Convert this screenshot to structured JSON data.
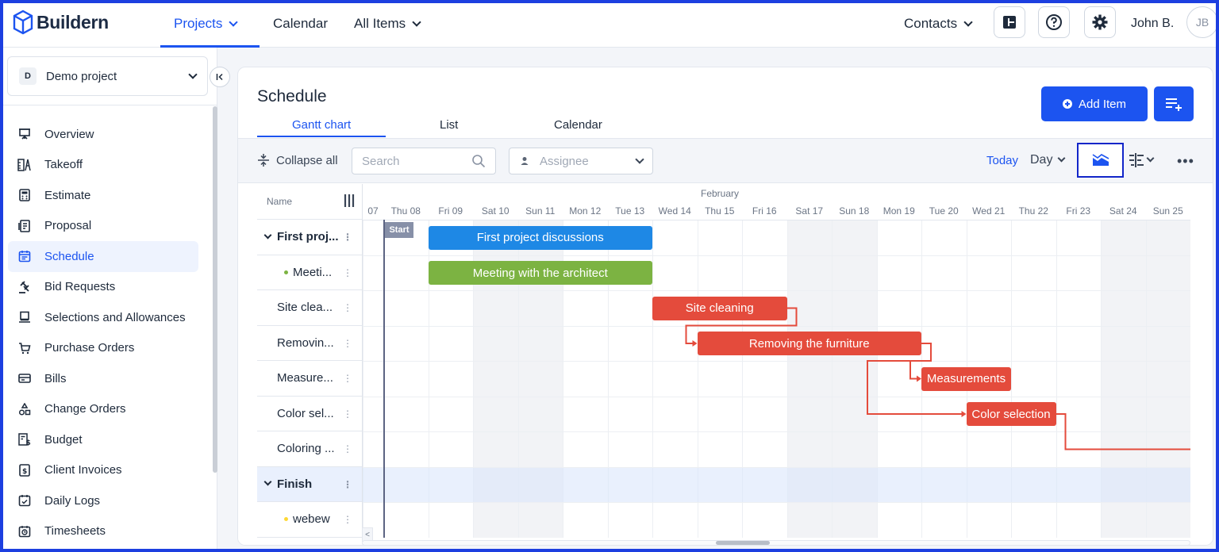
{
  "app": {
    "name": "Buildern"
  },
  "topnav": {
    "projects": "Projects",
    "calendar": "Calendar",
    "all_items": "All Items",
    "contacts": "Contacts",
    "user_name": "John B.",
    "user_initials": "JB"
  },
  "sidebar": {
    "project_initial": "D",
    "project_name": "Demo project",
    "items": [
      {
        "label": "Overview",
        "icon": "presentation-icon"
      },
      {
        "label": "Takeoff",
        "icon": "takeoff-icon"
      },
      {
        "label": "Estimate",
        "icon": "calculator-icon"
      },
      {
        "label": "Proposal",
        "icon": "proposal-icon"
      },
      {
        "label": "Schedule",
        "icon": "calendar-icon"
      },
      {
        "label": "Bid Requests",
        "icon": "gavel-icon"
      },
      {
        "label": "Selections and Allowances",
        "icon": "monitor-icon"
      },
      {
        "label": "Purchase Orders",
        "icon": "cart-icon"
      },
      {
        "label": "Bills",
        "icon": "bill-icon"
      },
      {
        "label": "Change Orders",
        "icon": "shapes-icon"
      },
      {
        "label": "Budget",
        "icon": "budget-icon"
      },
      {
        "label": "Client Invoices",
        "icon": "invoice-icon"
      },
      {
        "label": "Daily Logs",
        "icon": "daily-log-icon"
      },
      {
        "label": "Timesheets",
        "icon": "timesheet-icon"
      }
    ]
  },
  "page": {
    "title": "Schedule",
    "tabs": [
      "Gantt chart",
      "List",
      "Calendar"
    ],
    "add_item": "Add Item"
  },
  "toolbar": {
    "collapse_all": "Collapse all",
    "search_placeholder": "Search",
    "assignee_placeholder": "Assignee",
    "today": "Today",
    "day": "Day",
    "more": "•••"
  },
  "gantt": {
    "name_header": "Name",
    "month": "February",
    "days": [
      "07",
      "Thu 08",
      "Fri 09",
      "Sat 10",
      "Sun 11",
      "Mon 12",
      "Tue 13",
      "Wed 14",
      "Thu 15",
      "Fri 16",
      "Sat 17",
      "Sun 18",
      "Mon 19",
      "Tue 20",
      "Wed 21",
      "Thu 22",
      "Fri 23",
      "Sat 24",
      "Sun 25"
    ],
    "weekend_flags": [
      false,
      false,
      false,
      true,
      true,
      false,
      false,
      false,
      false,
      false,
      true,
      true,
      false,
      false,
      false,
      false,
      false,
      true,
      true
    ],
    "rows": [
      {
        "name": "First proj...",
        "type": "group"
      },
      {
        "name": "Meeti...",
        "type": "task",
        "dot_color": "#7cb342"
      },
      {
        "name": "Site clea...",
        "type": "task"
      },
      {
        "name": "Removin...",
        "type": "task"
      },
      {
        "name": "Measure...",
        "type": "task"
      },
      {
        "name": "Color sel...",
        "type": "task"
      },
      {
        "name": "Coloring ...",
        "type": "task"
      },
      {
        "name": "Finish",
        "type": "group"
      },
      {
        "name": "webew",
        "type": "task",
        "dot_color": "#fdd835"
      }
    ],
    "start_label": "Start",
    "bars": [
      {
        "label": "First project discussions",
        "row": 0,
        "start_day": "Fri 09",
        "end_day": "Tue 13",
        "color": "#1e88e5"
      },
      {
        "label": "Meeting with the architect",
        "row": 1,
        "start_day": "Fri 09",
        "end_day": "Tue 13",
        "color": "#7cb342"
      },
      {
        "label": "Site cleaning",
        "row": 2,
        "start_day": "Wed 14",
        "end_day": "Fri 16",
        "color": "#e44b3c"
      },
      {
        "label": "Removing the furniture",
        "row": 3,
        "start_day": "Thu 15",
        "end_day": "Mon 19",
        "color": "#e44b3c"
      },
      {
        "label": "Measurements",
        "row": 4,
        "start_day": "Tue 20",
        "end_day": "Wed 21",
        "color": "#e44b3c"
      },
      {
        "label": "Color selection",
        "row": 5,
        "start_day": "Wed 21",
        "end_day": "Thu 22",
        "color": "#e44b3c"
      }
    ]
  }
}
